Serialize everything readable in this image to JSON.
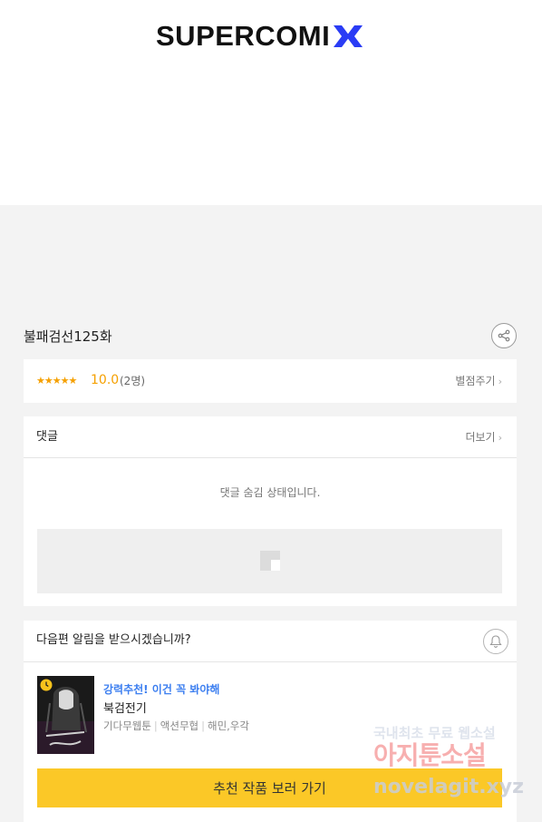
{
  "header": {
    "logo_text": "SUPERCOMI",
    "logo_mark": "X"
  },
  "episode": {
    "title": "불패검선125화"
  },
  "rating": {
    "stars": "★★★★★",
    "score": "10.0",
    "count": "(2명)",
    "rate_link": "별점주기"
  },
  "comments": {
    "title": "댓글",
    "more_label": "더보기",
    "hidden_message": "댓글 숨김 상태입니다."
  },
  "notify": {
    "question": "다음편 알림을 받으시겠습니까?"
  },
  "recommendation": {
    "tag": "강력추천! 이건 꼭 봐야해",
    "title": "북검전기",
    "genres": [
      "기다무웹툰",
      "액션무협",
      "해민,우각"
    ],
    "cta_label": "추천 작품 보러 가기"
  },
  "watermark": {
    "line1": "국내최초 무료 웹소설",
    "line2": "아지툰소설",
    "line3": "novelagit.xyz"
  },
  "colors": {
    "accent": "#f5a000",
    "cta": "#fbc827",
    "tag": "#3d7ff0",
    "logo_x": "#2a3cf5"
  },
  "icons": [
    "share-icon",
    "chevron-right-icon",
    "image-placeholder-icon",
    "bell-icon",
    "clock-badge-icon"
  ]
}
